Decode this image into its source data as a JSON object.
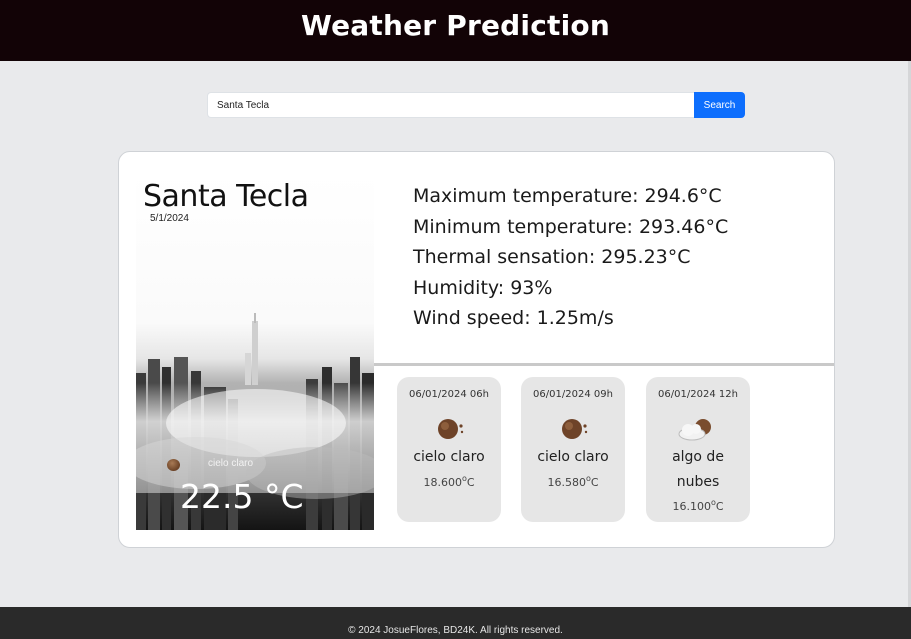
{
  "header": {
    "title": "Weather Prediction"
  },
  "search": {
    "value": "Santa Tecla",
    "button_label": "Search"
  },
  "current": {
    "city": "Santa Tecla",
    "date": "5/1/2024",
    "condition": "cielo claro",
    "temperature": "22.5 °C"
  },
  "details": {
    "max_temp": "Maximum temperature: 294.6°C",
    "min_temp": "Minimum temperature: 293.46°C",
    "thermal": "Thermal sensation: 295.23°C",
    "humidity": "Humidity: 93%",
    "wind": "Wind speed: 1.25m/s"
  },
  "forecast": [
    {
      "datetime": "06/01/2024 06h",
      "icon": "clear-night-icon",
      "description": "cielo claro",
      "temp": "18.600",
      "unit": "C"
    },
    {
      "datetime": "06/01/2024 09h",
      "icon": "clear-night-icon",
      "description": "cielo claro",
      "temp": "16.580",
      "unit": "C"
    },
    {
      "datetime": "06/01/2024 12h",
      "icon": "few-clouds-icon",
      "description": "algo de nubes",
      "temp": "16.100",
      "unit": "C"
    }
  ],
  "footer": {
    "text": "© 2024 JosueFlores, BD24K. All rights reserved."
  }
}
